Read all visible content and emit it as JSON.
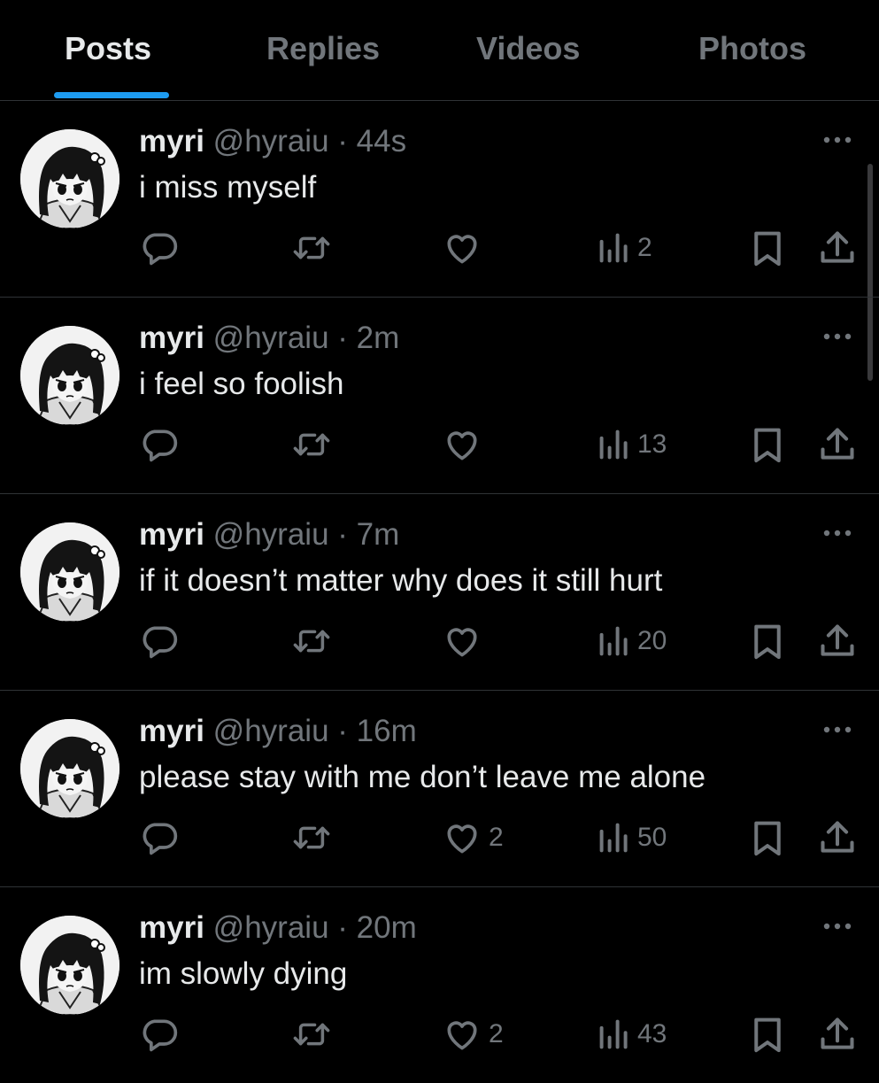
{
  "tabs": [
    {
      "label": "Posts",
      "active": true
    },
    {
      "label": "Replies",
      "active": false
    },
    {
      "label": "Videos",
      "active": false
    },
    {
      "label": "Photos",
      "active": false
    }
  ],
  "colors": {
    "background": "#000000",
    "text": "#e7e9ea",
    "muted": "#71767b",
    "accent": "#1d9bf0",
    "divider": "#2f3336"
  },
  "icons": {
    "reply": "reply-icon",
    "retweet": "retweet-icon",
    "like": "heart-icon",
    "views": "views-chart-icon",
    "bookmark": "bookmark-icon",
    "share": "share-icon",
    "more": "more-dots-icon"
  },
  "posts": [
    {
      "name": "myri",
      "handle": "@hyraiu",
      "dot": "·",
      "time": "44s",
      "text": "i miss myself",
      "likes": "",
      "views": "2"
    },
    {
      "name": "myri",
      "handle": "@hyraiu",
      "dot": "·",
      "time": "2m",
      "text": "i feel so foolish",
      "likes": "",
      "views": "13"
    },
    {
      "name": "myri",
      "handle": "@hyraiu",
      "dot": "·",
      "time": "7m",
      "text": "if it doesn’t matter why does it still hurt",
      "likes": "",
      "views": "20"
    },
    {
      "name": "myri",
      "handle": "@hyraiu",
      "dot": "·",
      "time": "16m",
      "text": "please stay with me don’t leave me alone",
      "likes": "2",
      "views": "50"
    },
    {
      "name": "myri",
      "handle": "@hyraiu",
      "dot": "·",
      "time": "20m",
      "text": "im slowly dying",
      "likes": "2",
      "views": "43"
    }
  ]
}
